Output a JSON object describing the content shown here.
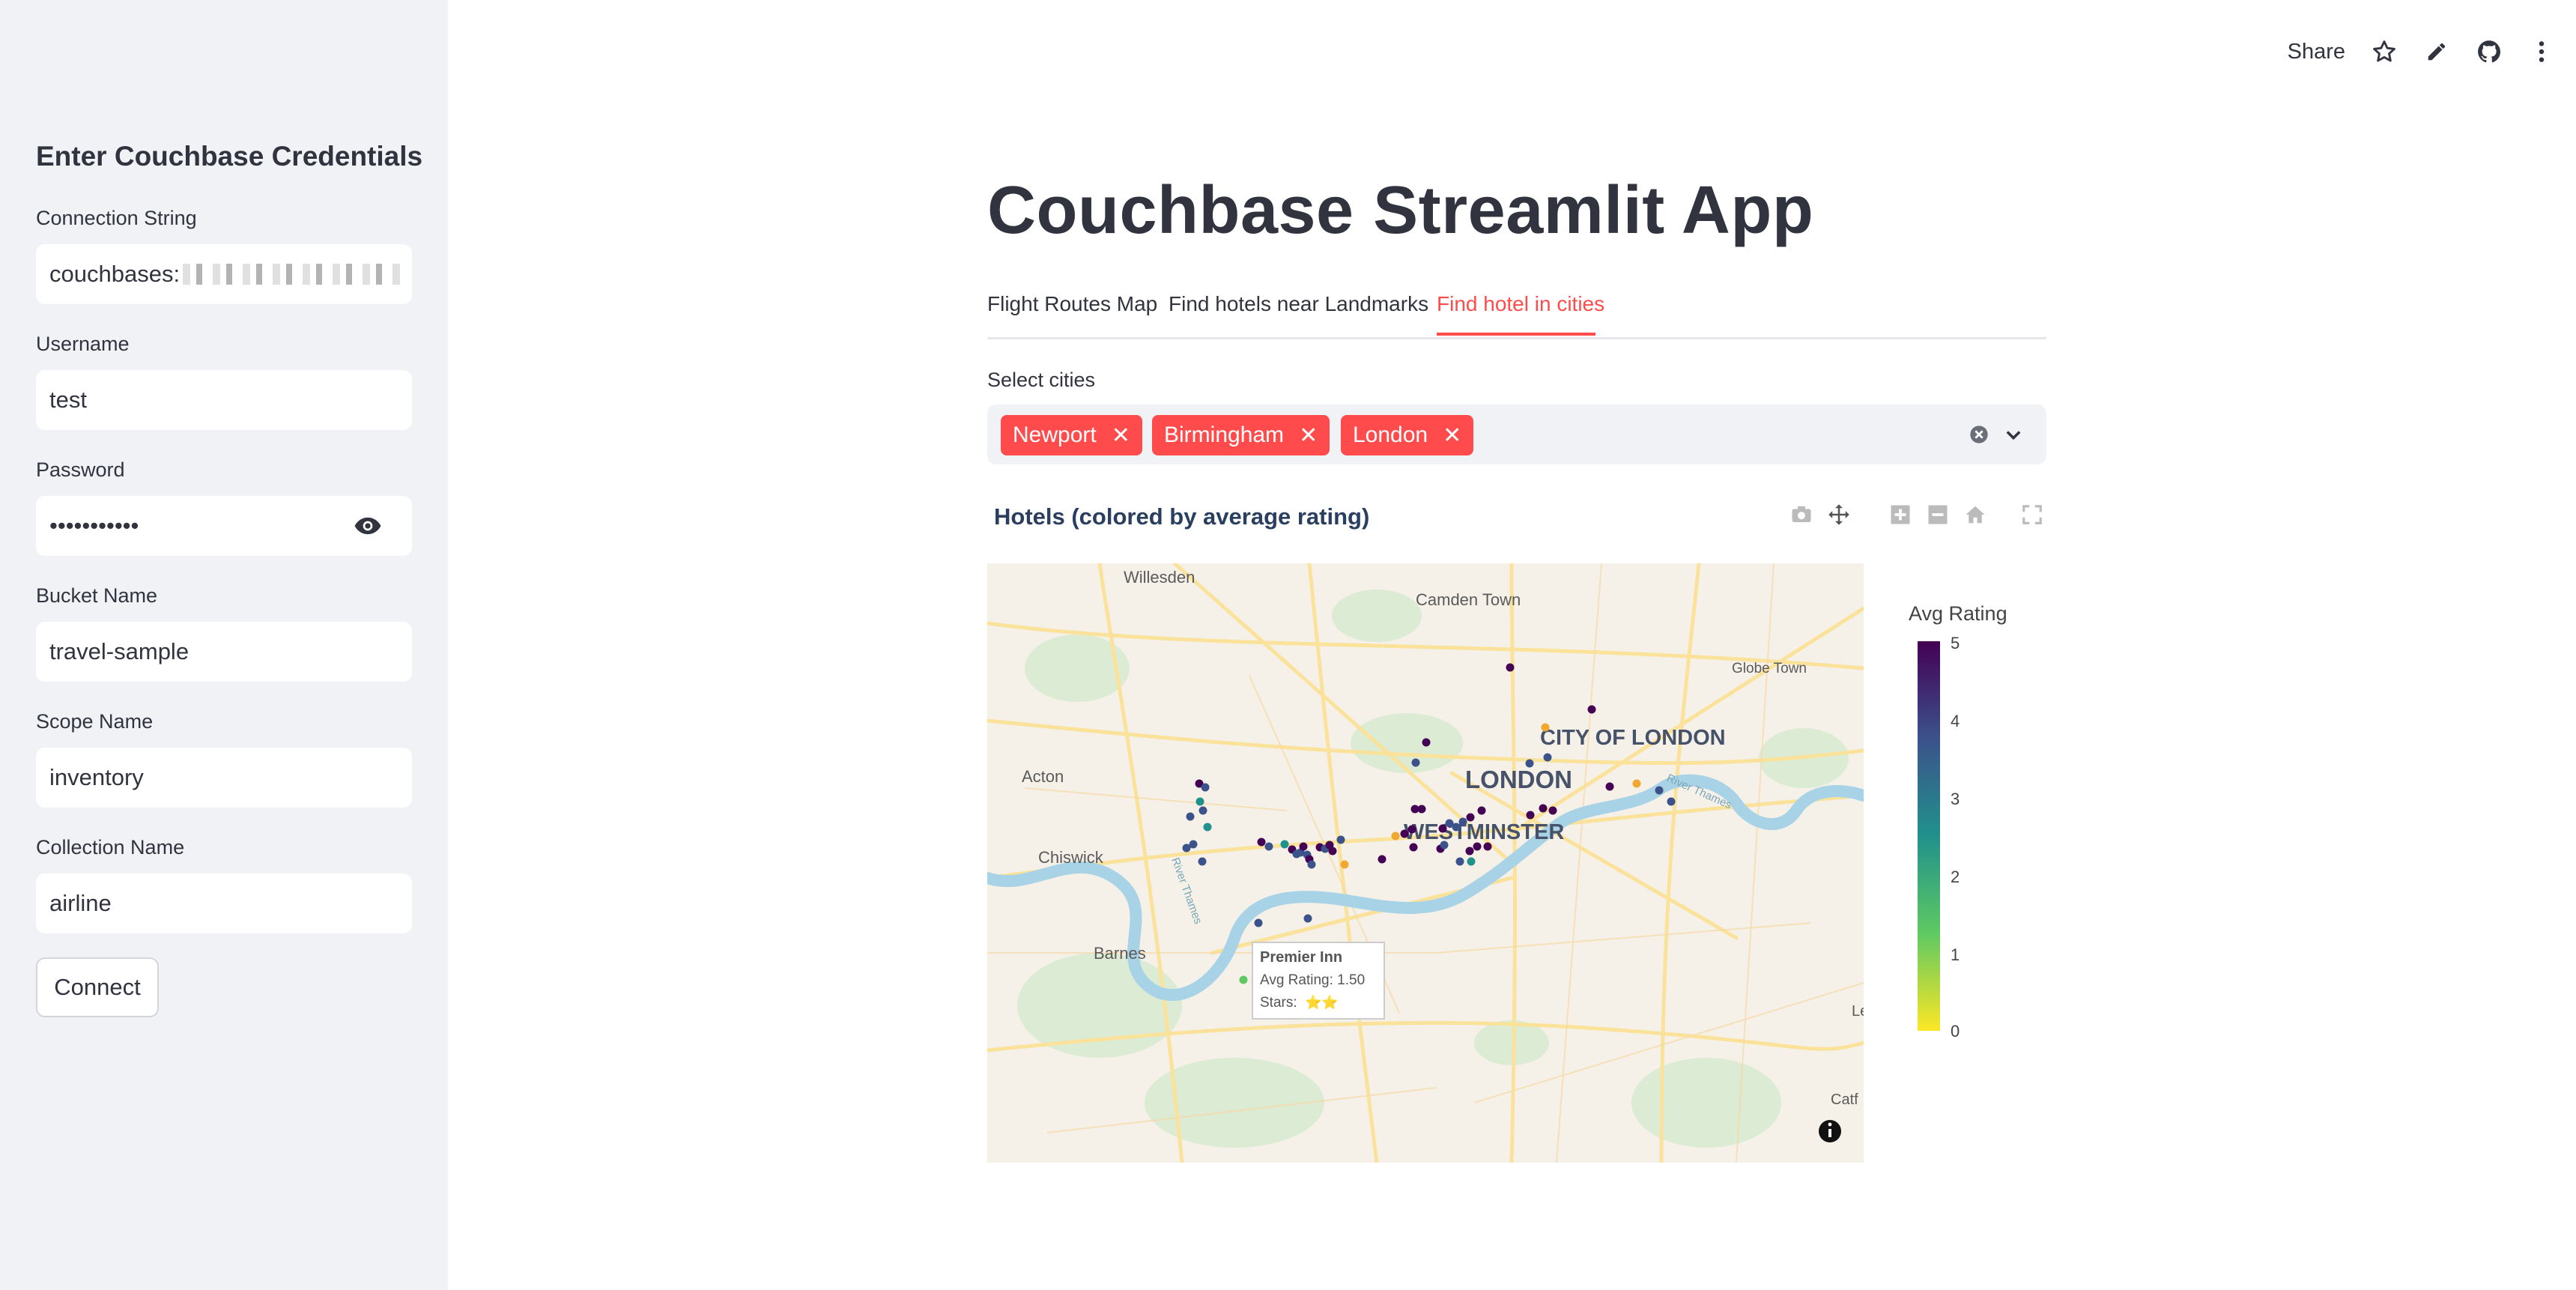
{
  "sidebar": {
    "title": "Enter Couchbase Credentials",
    "fields": [
      {
        "label": "Connection String",
        "value": "couchbases:"
      },
      {
        "label": "Username",
        "value": "test"
      },
      {
        "label": "Password",
        "value": "•••••••••••"
      },
      {
        "label": "Bucket Name",
        "value": "travel-sample"
      },
      {
        "label": "Scope Name",
        "value": "inventory"
      },
      {
        "label": "Collection Name",
        "value": "airline"
      }
    ],
    "connect_label": "Connect"
  },
  "toolbar": {
    "share_label": "Share",
    "icons": [
      "star-icon",
      "pencil-icon",
      "github-icon",
      "more-vertical-icon"
    ]
  },
  "main": {
    "title": "Couchbase Streamlit App",
    "tabs": [
      {
        "label": "Flight Routes Map",
        "active": false
      },
      {
        "label": "Find hotels near Landmarks",
        "active": false
      },
      {
        "label": "Find hotel in cities",
        "active": true
      }
    ],
    "select_label": "Select cities",
    "selected_cities": [
      "Newport",
      "Birmingham",
      "London"
    ]
  },
  "chart": {
    "title": "Hotels (colored by average rating)",
    "colorbar_title": "Avg Rating",
    "colorbar_ticks": [
      "5",
      "4",
      "3",
      "2",
      "1",
      "0"
    ],
    "map_labels": {
      "willesden": "Willesden",
      "camden": "Camden Town",
      "globe": "Globe Town",
      "city": "CITY OF LONDON",
      "london": "LONDON",
      "acton": "Acton",
      "westminster": "WESTMINSTER",
      "chiswick": "Chiswick",
      "barnes": "Barnes",
      "thames1": "River Thames",
      "thames2": "River Thames",
      "le": "Le",
      "catf": "Catf"
    },
    "tooltip": {
      "name": "Premier Inn",
      "rating": "Avg Rating: 1.50",
      "stars_label": "Stars:",
      "stars": "⭐⭐"
    }
  },
  "colors": {
    "accent": "#ff4b4b",
    "sidebar_bg": "#f0f2f6",
    "viridis_low": "#fde725",
    "viridis_high": "#440154"
  }
}
